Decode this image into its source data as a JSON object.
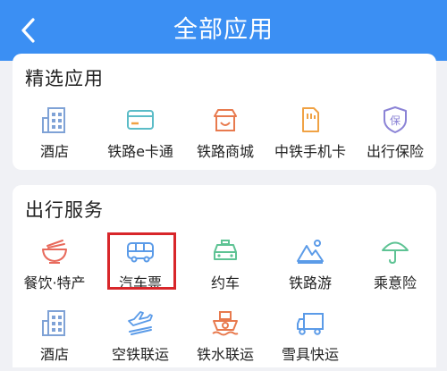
{
  "header": {
    "title": "全部应用",
    "back_icon": "chevron-left-icon"
  },
  "colors": {
    "header_bg": "#3b8ff3",
    "highlight_border": "#d8262a"
  },
  "selected_apps": {
    "title": "精选应用",
    "items": [
      {
        "label": "酒店",
        "icon": "hotel-building-icon"
      },
      {
        "label": "铁路e卡通",
        "icon": "card-icon"
      },
      {
        "label": "铁路商城",
        "icon": "shop-icon"
      },
      {
        "label": "中铁手机卡",
        "icon": "sim-card-icon"
      },
      {
        "label": "出行保险",
        "icon": "insurance-shield-icon"
      }
    ]
  },
  "travel_services": {
    "title": "出行服务",
    "items": [
      {
        "label": "餐饮·特产",
        "icon": "noodle-bowl-icon"
      },
      {
        "label": "汽车票",
        "icon": "bus-icon"
      },
      {
        "label": "约车",
        "icon": "car-icon"
      },
      {
        "label": "铁路游",
        "icon": "mountain-icon"
      },
      {
        "label": "乘意险",
        "icon": "umbrella-icon"
      },
      {
        "label": "酒店",
        "icon": "hotel-building-icon"
      },
      {
        "label": "空铁联运",
        "icon": "plane-train-icon"
      },
      {
        "label": "铁水联运",
        "icon": "ship-icon"
      },
      {
        "label": "雪具快运",
        "icon": "truck-icon"
      }
    ]
  }
}
